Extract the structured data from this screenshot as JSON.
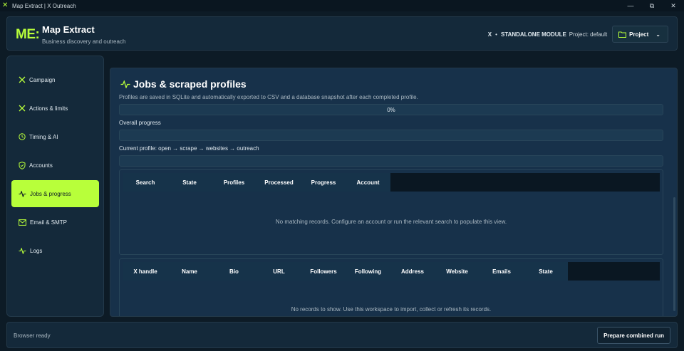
{
  "window": {
    "title": "Map Extract | X Outreach",
    "controls": {
      "minimize": "—",
      "restore": "⧉",
      "close": "✕"
    }
  },
  "header": {
    "logo": "ME:",
    "title": "Map Extract",
    "subtitle": "Business discovery and outreach",
    "platform": "X",
    "separator": "•",
    "module": "STANDALONE MODULE",
    "project_label": "Project: default",
    "project_button": "Project"
  },
  "sidebar": {
    "items": [
      {
        "label": "Campaign",
        "icon": "x-icon"
      },
      {
        "label": "Actions & limits",
        "icon": "x-icon"
      },
      {
        "label": "Timing & AI",
        "icon": "clock-icon"
      },
      {
        "label": "Accounts",
        "icon": "shield-check-icon"
      },
      {
        "label": "Jobs & progress",
        "icon": "activity-icon",
        "active": true
      },
      {
        "label": "Email & SMTP",
        "icon": "mail-icon"
      },
      {
        "label": "Logs",
        "icon": "activity-icon"
      }
    ]
  },
  "main": {
    "title": "Jobs & scraped profiles",
    "description": "Profiles are saved in SQLite and automatically exported to CSV and a database snapshot after each completed profile.",
    "progress_percent_label": "0%",
    "progress_value": 0,
    "overall_label": "Overall progress",
    "current_label": "Current profile: open → scrape → websites → outreach",
    "jobs_table": {
      "columns": [
        "Search",
        "State",
        "Profiles",
        "Processed",
        "Progress",
        "Account"
      ],
      "empty_message": "No matching records. Configure an account or run the relevant search to populate this view."
    },
    "profiles_table": {
      "columns": [
        "X handle",
        "Name",
        "Bio",
        "URL",
        "Followers",
        "Following",
        "Address",
        "Website",
        "Emails",
        "State"
      ],
      "empty_message": "No records to show. Use this workspace to import, collect or refresh its records."
    }
  },
  "footer": {
    "status": "Browser ready",
    "run_button": "Prepare combined run"
  },
  "colors": {
    "accent": "#b8ff3a",
    "background": "#0d1b26",
    "panel": "#14293a"
  }
}
